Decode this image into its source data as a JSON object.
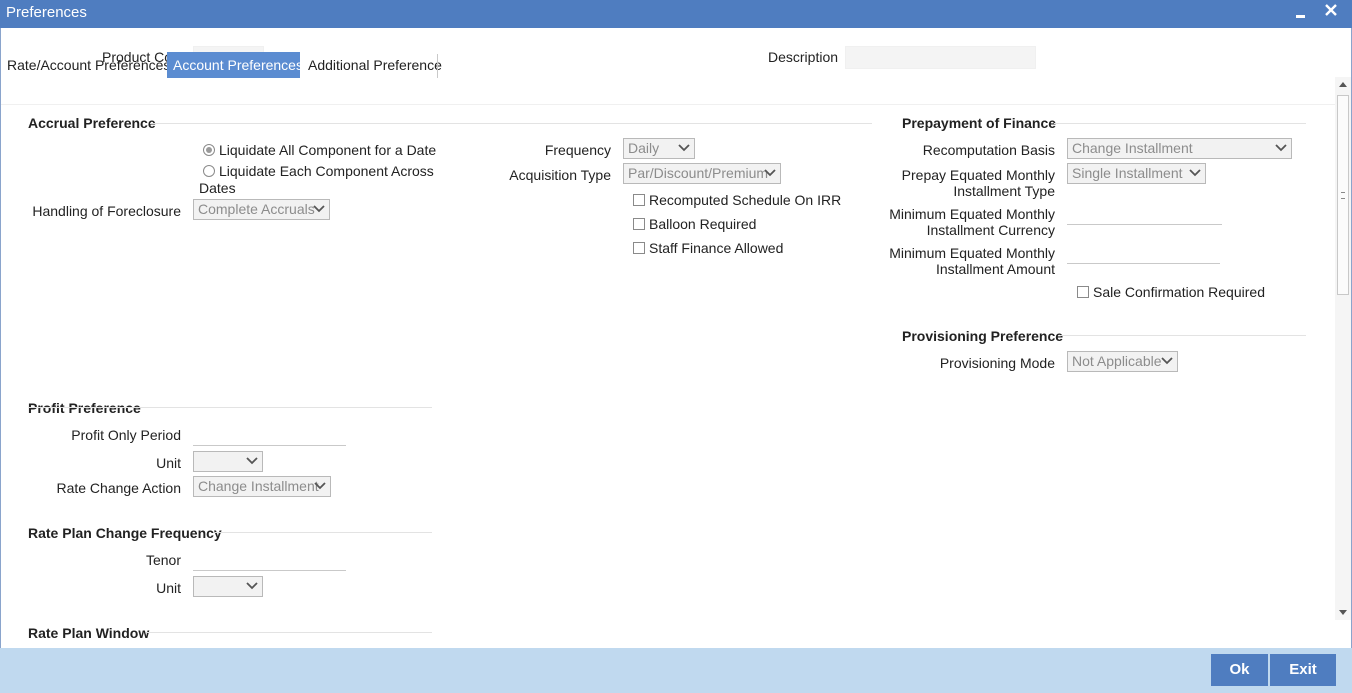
{
  "window": {
    "title": "Preferences"
  },
  "header": {
    "product_code_label": "Product Code",
    "product_code_value": "",
    "description_label": "Description",
    "description_value": ""
  },
  "tabs": [
    {
      "label": "Rate/Account Preferences",
      "active": false
    },
    {
      "label": "Account Preferences",
      "active": true
    },
    {
      "label": "Additional Preference",
      "active": false
    }
  ],
  "accrual": {
    "title": "Accrual Preference",
    "option_all": "Liquidate All Component for a Date",
    "option_each_line1": "Liquidate Each Component Across",
    "option_each_line2": "Dates",
    "selected_option": "option_all",
    "foreclosure_label": "Handling of Foreclosure",
    "foreclosure_value": "Complete Accruals",
    "frequency_label": "Frequency",
    "frequency_value": "Daily",
    "acquisition_label": "Acquisition Type",
    "acquisition_value": "Par/Discount/Premium",
    "recomputed_label": "Recomputed Schedule On IRR",
    "recomputed_checked": false,
    "balloon_label": "Balloon Required",
    "balloon_checked": false,
    "staff_label": "Staff Finance Allowed",
    "staff_checked": false
  },
  "prepayment": {
    "title": "Prepayment of Finance",
    "recomputation_label": "Recomputation Basis",
    "recomputation_value": "Change Installment",
    "prepay_type_line1": "Prepay Equated Monthly",
    "prepay_type_line2": "Installment Type",
    "prepay_type_value": "Single Installment",
    "min_currency_line1": "Minimum Equated Monthly",
    "min_currency_line2": "Installment Currency",
    "min_currency_value": "",
    "min_amount_line1": "Minimum Equated Monthly",
    "min_amount_line2": "Installment Amount",
    "min_amount_value": "",
    "sale_confirmation_label": "Sale Confirmation Required",
    "sale_confirmation_checked": false
  },
  "provisioning": {
    "title": "Provisioning Preference",
    "mode_label": "Provisioning Mode",
    "mode_value": "Not Applicable"
  },
  "profit": {
    "title": "Profit Preference",
    "period_label": "Profit Only Period",
    "period_value": "",
    "unit_label": "Unit",
    "unit_value": "",
    "rate_change_label": "Rate Change Action",
    "rate_change_value": "Change Installment"
  },
  "rate_plan_change": {
    "title": "Rate Plan Change Frequency",
    "tenor_label": "Tenor",
    "tenor_value": "",
    "unit_label": "Unit",
    "unit_value": ""
  },
  "rate_plan_window": {
    "title": "Rate Plan Window"
  },
  "footer": {
    "ok_label": "Ok",
    "exit_label": "Exit"
  },
  "colors": {
    "titlebar": "#4f7dc0",
    "active_tab": "#5b8cd1",
    "footer": "#c0d9ef",
    "button": "#4f7dc0"
  }
}
